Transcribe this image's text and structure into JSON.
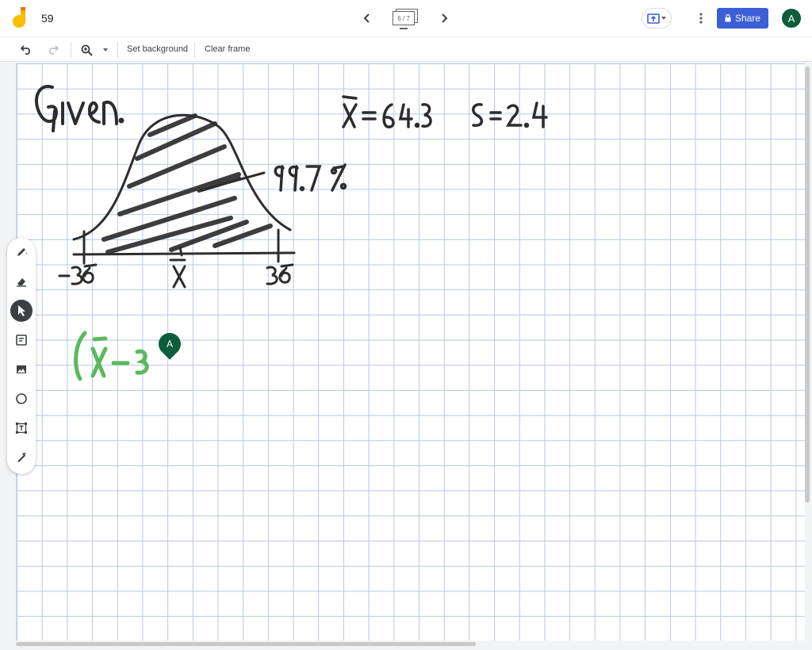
{
  "app": {
    "doc_title": "59"
  },
  "frame_nav": {
    "frame_indicator": "6 / 7"
  },
  "header": {
    "share_label": "Share",
    "avatar_initial": "A"
  },
  "toolbar": {
    "set_background_label": "Set background",
    "clear_frame_label": "Clear frame"
  },
  "tools": [
    "pen-icon",
    "eraser-icon",
    "select-icon",
    "sticky-note-icon",
    "image-icon",
    "circle-icon",
    "text-box-icon",
    "laser-icon"
  ],
  "active_tool": "select-icon",
  "canvas": {
    "handwriting": {
      "given": "Given",
      "mean_eq": "x̄ = 64.3",
      "sd_eq": "S = 2.4",
      "pct": "99.7 %",
      "left_tick": "−3σ",
      "center_tick": "x̄",
      "right_tick": "3σ",
      "green_expr": "(x̄ − 3"
    },
    "ink_colors": {
      "black": "#2d2d2d",
      "green": "#5cb85c"
    }
  },
  "collaborator": {
    "initial": "A",
    "color": "#0b5d3b"
  },
  "colors": {
    "share": "#3c5fd6",
    "grid": "#b7c7e3"
  }
}
